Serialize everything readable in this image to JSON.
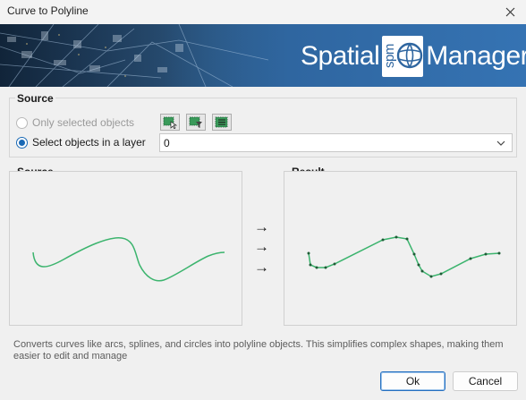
{
  "window": {
    "title": "Curve to Polyline",
    "close_label": "✕"
  },
  "banner": {
    "brand_left": "Spatial",
    "brand_logo": "spm",
    "brand_right": "Manager"
  },
  "source_group": {
    "label": "Source",
    "radio_only_selected": {
      "label": "Only selected objects",
      "checked": false,
      "enabled": false
    },
    "radio_layer": {
      "label": "Select objects in a layer",
      "checked": true
    },
    "tools": [
      "select-objects-icon",
      "select-filter-icon",
      "select-all-icon"
    ],
    "layer_combo": {
      "value": "0"
    }
  },
  "preview": {
    "source_label": "Source",
    "result_label": "Result",
    "arrows": [
      "→",
      "→",
      "→"
    ],
    "curve_color": "#3cb46e",
    "vertex_color": "#1e5c36"
  },
  "description": "Converts curves like arcs, splines, and circles into polyline objects. This simplifies complex shapes, making them easier to edit and manage",
  "buttons": {
    "ok": "Ok",
    "cancel": "Cancel"
  }
}
